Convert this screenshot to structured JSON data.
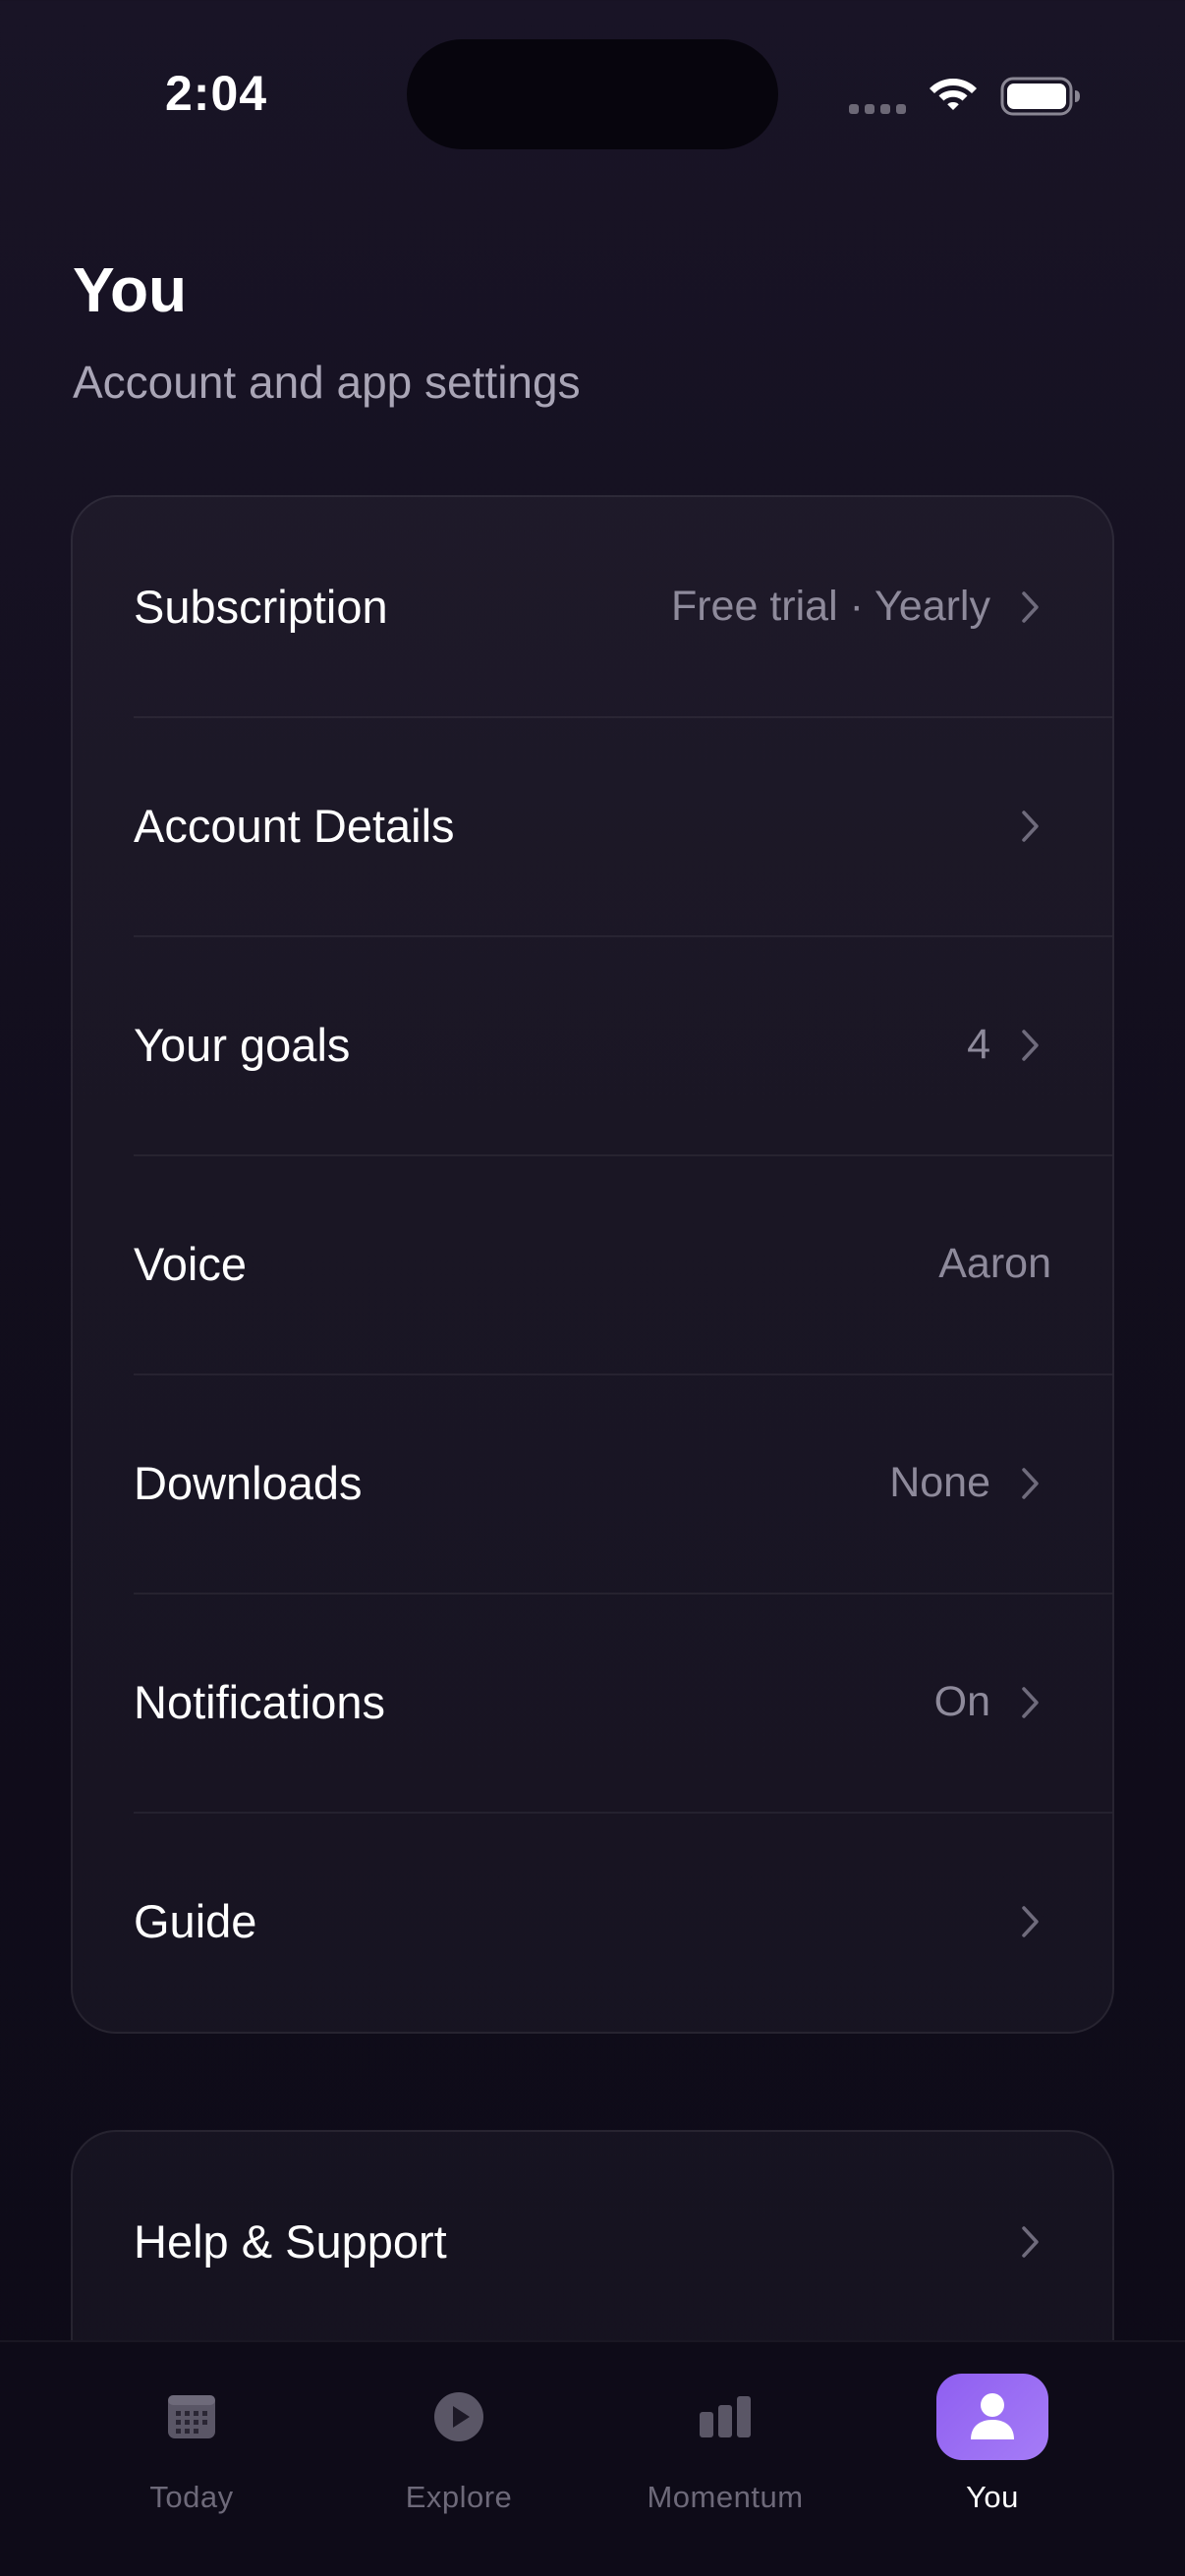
{
  "status_bar": {
    "time": "2:04"
  },
  "header": {
    "title": "You",
    "subtitle": "Account and app settings"
  },
  "settings": {
    "rows": [
      {
        "label": "Subscription",
        "value": "Free trial · Yearly",
        "chevron": true
      },
      {
        "label": "Account Details",
        "value": "",
        "chevron": true
      },
      {
        "label": "Your goals",
        "value": "4",
        "chevron": true
      },
      {
        "label": "Voice",
        "value": "Aaron",
        "chevron": false
      },
      {
        "label": "Downloads",
        "value": "None",
        "chevron": true
      },
      {
        "label": "Notifications",
        "value": "On",
        "chevron": true
      },
      {
        "label": "Guide",
        "value": "",
        "chevron": true
      }
    ]
  },
  "support": {
    "rows": [
      {
        "label": "Help & Support",
        "value": "",
        "chevron": true
      }
    ]
  },
  "tab_bar": {
    "tabs": [
      {
        "label": "Today",
        "icon": "calendar-icon",
        "active": false
      },
      {
        "label": "Explore",
        "icon": "play-circle-icon",
        "active": false
      },
      {
        "label": "Momentum",
        "icon": "bar-chart-icon",
        "active": false
      },
      {
        "label": "You",
        "icon": "person-icon",
        "active": true
      }
    ]
  },
  "colors": {
    "background": "#120e1d",
    "accent": "#9a6ef4",
    "muted_text": "#8e8a9b"
  }
}
